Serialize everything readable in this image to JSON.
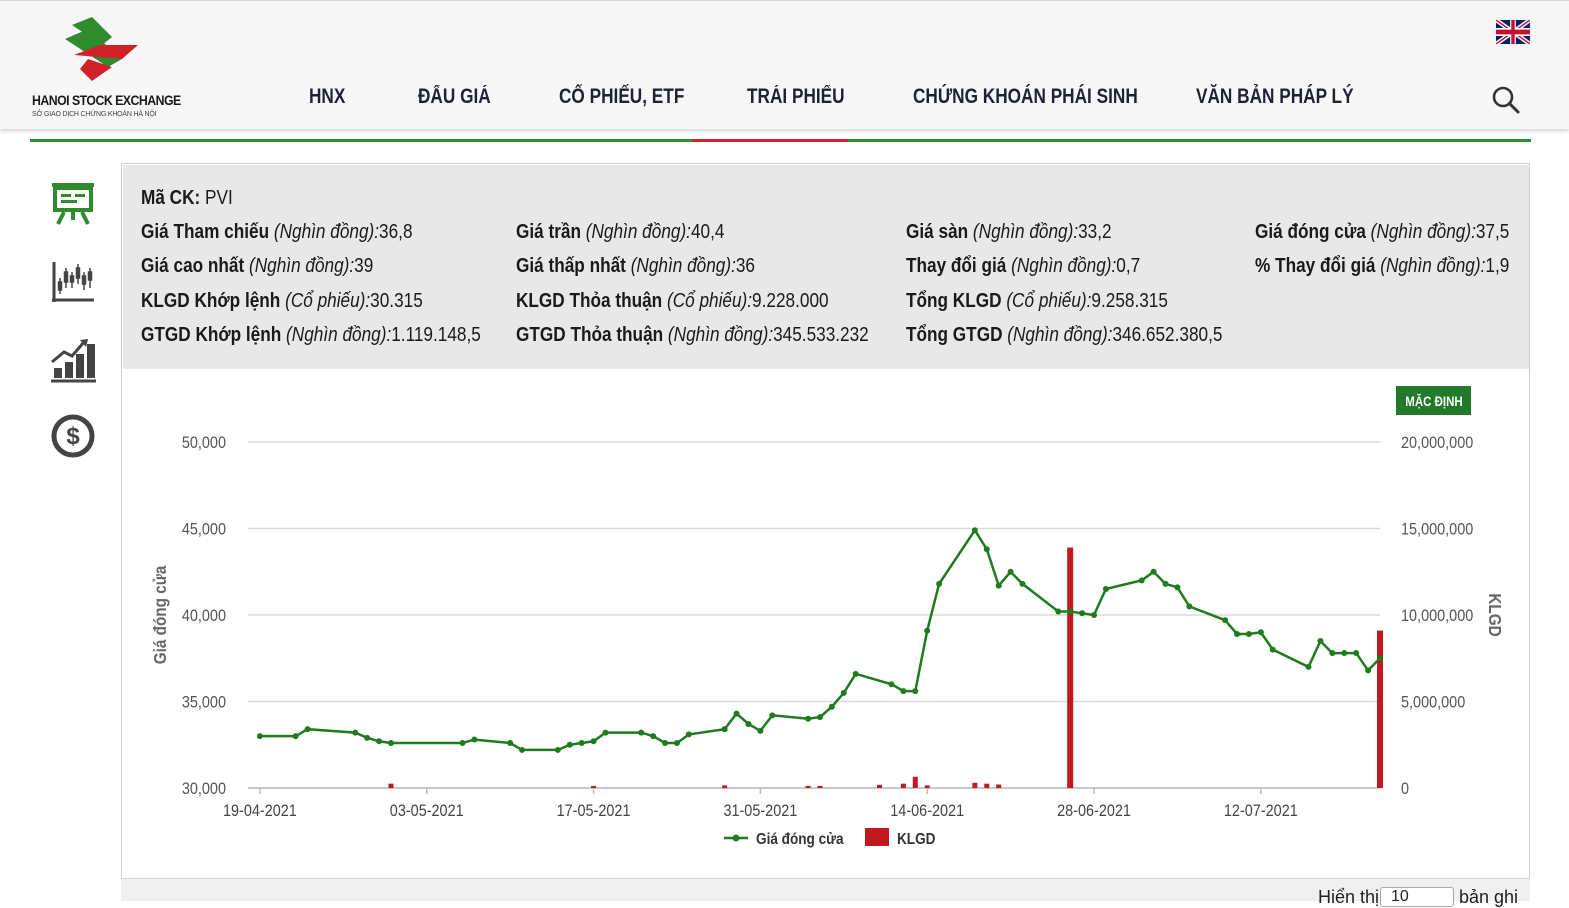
{
  "header": {
    "logo_text": "HANOI STOCK EXCHANGE",
    "logo_sub": "SỞ GIAO DỊCH CHỨNG KHOÁN HÀ NỘI",
    "nav": [
      "HNX",
      "ĐẤU GIÁ",
      "CỔ PHIẾU, ETF",
      "TRÁI PHIẾU",
      "CHỨNG KHOÁN PHÁI SINH",
      "VĂN BẢN PHÁP LÝ"
    ],
    "active_nav": "TRÁI PHIẾU",
    "icons": [
      "uk-flag-icon",
      "search-icon"
    ]
  },
  "sidebar": {
    "icons": [
      "presentation-board-icon",
      "candlestick-chart-icon",
      "growth-bar-chart-icon",
      "dollar-coin-icon"
    ]
  },
  "info": {
    "ma_ck": {
      "label": "Mã CK:",
      "value": "PVI"
    },
    "rows": [
      [
        {
          "label": "Giá Tham chiếu",
          "unit": "(Nghìn đồng):",
          "value": "36,8"
        },
        {
          "label": "Giá trần",
          "unit": "(Nghìn đồng):",
          "value": "40,4"
        },
        {
          "label": "Giá sàn",
          "unit": "(Nghìn đồng):",
          "value": "33,2"
        },
        {
          "label": "Giá đóng cửa",
          "unit": "(Nghìn đồng):",
          "value": "37,5"
        }
      ],
      [
        {
          "label": "Giá cao nhất",
          "unit": "(Nghìn đồng):",
          "value": "39"
        },
        {
          "label": "Giá thấp nhất",
          "unit": "(Nghìn đồng):",
          "value": "36"
        },
        {
          "label": "Thay đổi giá",
          "unit": "(Nghìn đồng):",
          "value": "0,7"
        },
        {
          "label": "% Thay đổi giá",
          "unit": "(Nghìn đồng):",
          "value": "1,9"
        }
      ],
      [
        {
          "label": "KLGD Khớp lệnh",
          "unit": "(Cổ phiếu):",
          "value": "30.315"
        },
        {
          "label": "KLGD Thỏa thuận",
          "unit": "(Cổ phiếu):",
          "value": "9.228.000"
        },
        {
          "label": "Tổng KLGD",
          "unit": "(Cổ phiếu):",
          "value": "9.258.315"
        }
      ],
      [
        {
          "label": "GTGD Khớp lệnh",
          "unit": "(Nghìn đồng):",
          "value": "1.119.148,5"
        },
        {
          "label": "GTGD Thỏa thuận",
          "unit": "(Nghìn đồng):",
          "value": "345.533.232"
        },
        {
          "label": "Tổng GTGD",
          "unit": "(Nghìn đồng):",
          "value": "346.652.380,5"
        }
      ]
    ]
  },
  "chart": {
    "default_button": "MẶC ĐỊNH"
  },
  "chart_data": {
    "type": "line",
    "title": "",
    "xlabel": "",
    "ylabel": "Giá đóng cửa",
    "y2label": "KLGD",
    "ylim": [
      30000,
      50000
    ],
    "y2lim": [
      0,
      20000000
    ],
    "yticks": [
      "30,000",
      "35,000",
      "40,000",
      "45,000",
      "50,000"
    ],
    "y2ticks": [
      "0",
      "5,000,000",
      "10,000,000",
      "15,000,000",
      "20,000,000"
    ],
    "xticks": [
      "19-04-2021",
      "03-05-2021",
      "17-05-2021",
      "31-05-2021",
      "14-06-2021",
      "28-06-2021",
      "12-07-2021"
    ],
    "xlim": [
      "2021-04-18",
      "2021-07-22"
    ],
    "grid": true,
    "legend_position": "bottom",
    "colors": {
      "price": "#1e7b1e",
      "volume": "#c0191f"
    },
    "series": [
      {
        "name": "Giá đóng cửa",
        "type": "line",
        "points": [
          [
            "2021-04-19",
            33000
          ],
          [
            "2021-04-22",
            33000
          ],
          [
            "2021-04-23",
            33400
          ],
          [
            "2021-04-27",
            33200
          ],
          [
            "2021-04-28",
            32900
          ],
          [
            "2021-04-29",
            32700
          ],
          [
            "2021-04-30",
            32600
          ],
          [
            "2021-05-06",
            32600
          ],
          [
            "2021-05-07",
            32800
          ],
          [
            "2021-05-10",
            32600
          ],
          [
            "2021-05-11",
            32200
          ],
          [
            "2021-05-14",
            32200
          ],
          [
            "2021-05-15",
            32500
          ],
          [
            "2021-05-16",
            32600
          ],
          [
            "2021-05-17",
            32700
          ],
          [
            "2021-05-18",
            33200
          ],
          [
            "2021-05-21",
            33200
          ],
          [
            "2021-05-22",
            33000
          ],
          [
            "2021-05-23",
            32600
          ],
          [
            "2021-05-24",
            32600
          ],
          [
            "2021-05-25",
            33100
          ],
          [
            "2021-05-28",
            33400
          ],
          [
            "2021-05-29",
            34300
          ],
          [
            "2021-05-30",
            33700
          ],
          [
            "2021-05-31",
            33300
          ],
          [
            "2021-06-01",
            34200
          ],
          [
            "2021-06-04",
            34000
          ],
          [
            "2021-06-05",
            34100
          ],
          [
            "2021-06-06",
            34700
          ],
          [
            "2021-06-07",
            35500
          ],
          [
            "2021-06-08",
            36600
          ],
          [
            "2021-06-11",
            36000
          ],
          [
            "2021-06-12",
            35600
          ],
          [
            "2021-06-13",
            35600
          ],
          [
            "2021-06-14",
            39100
          ],
          [
            "2021-06-15",
            41800
          ],
          [
            "2021-06-18",
            44900
          ],
          [
            "2021-06-19",
            43800
          ],
          [
            "2021-06-20",
            41700
          ],
          [
            "2021-06-21",
            42500
          ],
          [
            "2021-06-22",
            41800
          ],
          [
            "2021-06-25",
            40200
          ],
          [
            "2021-06-26",
            40200
          ],
          [
            "2021-06-27",
            40100
          ],
          [
            "2021-06-28",
            40000
          ],
          [
            "2021-06-29",
            41500
          ],
          [
            "2021-07-02",
            42000
          ],
          [
            "2021-07-03",
            42500
          ],
          [
            "2021-07-04",
            41800
          ],
          [
            "2021-07-05",
            41600
          ],
          [
            "2021-07-06",
            40500
          ],
          [
            "2021-07-09",
            39700
          ],
          [
            "2021-07-10",
            38900
          ],
          [
            "2021-07-11",
            38900
          ],
          [
            "2021-07-12",
            39000
          ],
          [
            "2021-07-13",
            38000
          ],
          [
            "2021-07-16",
            37000
          ],
          [
            "2021-07-17",
            38500
          ],
          [
            "2021-07-18",
            37800
          ],
          [
            "2021-07-19",
            37800
          ],
          [
            "2021-07-20",
            37800
          ],
          [
            "2021-07-21",
            36800
          ],
          [
            "2021-07-22",
            37500
          ]
        ]
      },
      {
        "name": "KLGD",
        "type": "bar",
        "points": [
          [
            "2021-04-30",
            250000
          ],
          [
            "2021-05-17",
            120000
          ],
          [
            "2021-05-28",
            150000
          ],
          [
            "2021-06-04",
            120000
          ],
          [
            "2021-06-05",
            120000
          ],
          [
            "2021-06-10",
            180000
          ],
          [
            "2021-06-12",
            250000
          ],
          [
            "2021-06-13",
            650000
          ],
          [
            "2021-06-14",
            150000
          ],
          [
            "2021-06-18",
            300000
          ],
          [
            "2021-06-19",
            250000
          ],
          [
            "2021-06-20",
            200000
          ],
          [
            "2021-06-26",
            13900000
          ],
          [
            "2021-07-22",
            9100000
          ]
        ]
      }
    ]
  },
  "footer": {
    "show_label": "Hiển thị",
    "page_size": "10",
    "records_label": "bản ghi"
  }
}
